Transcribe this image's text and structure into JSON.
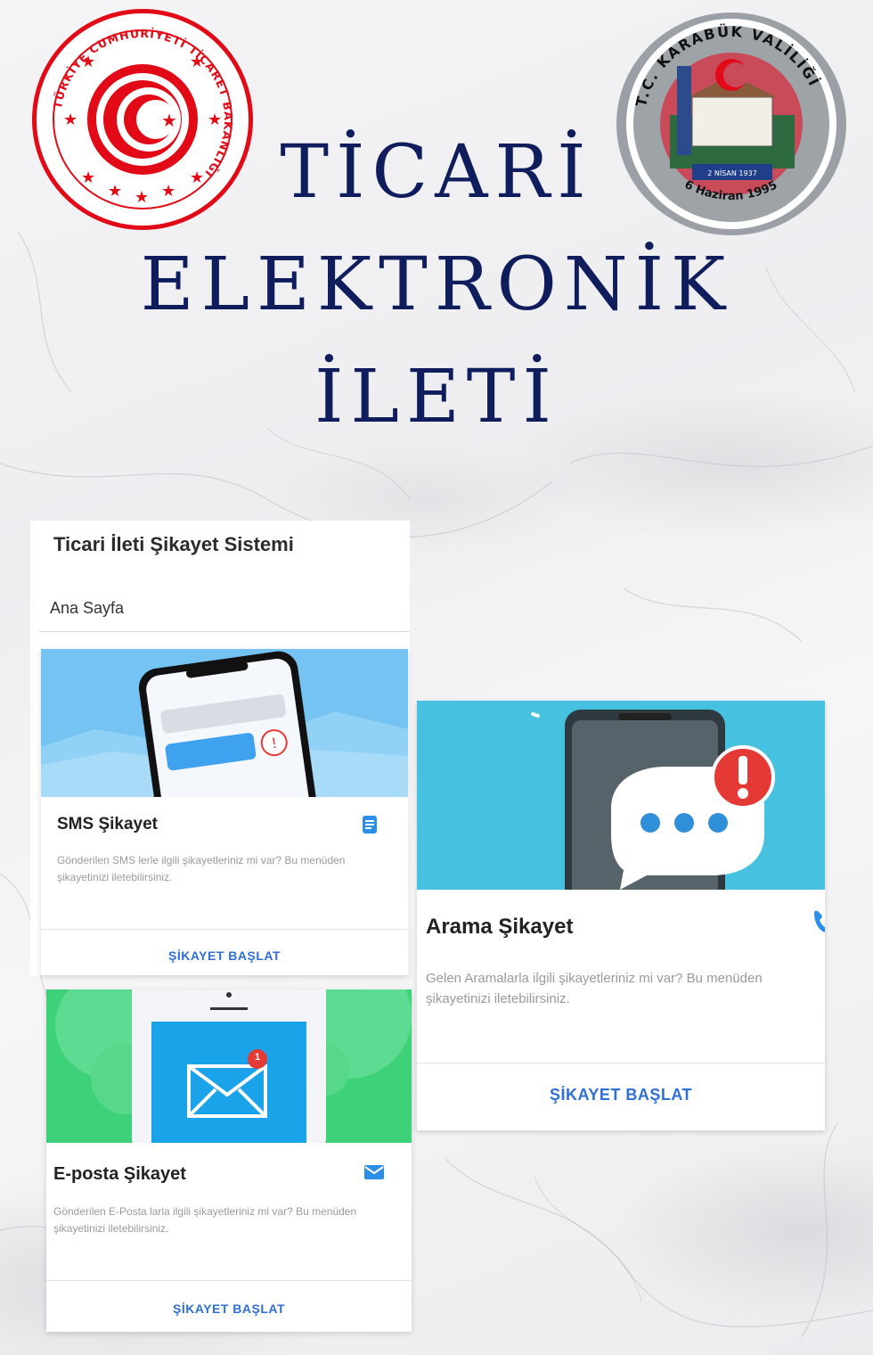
{
  "title": {
    "line1": "TİCARİ",
    "line2": "ELEKTRONİK",
    "line3": "İLETİ"
  },
  "logos": {
    "left": {
      "name": "ticaret-bakanligi-logo",
      "ring_text": "TÜRKİYE CUMHURİYETİ TİCARET BAKANLIĞI"
    },
    "right": {
      "name": "karabuk-valiligi-logo",
      "ring_text": "T.C. KARABÜK VALİLİĞİ",
      "ribbon_text": "2 NİSAN 1937",
      "bottom_text": "6 Haziran 1995"
    }
  },
  "app": {
    "title": "Ticari İleti Şikayet Sistemi",
    "breadcrumb": "Ana Sayfa"
  },
  "cards": {
    "sms": {
      "title": "SMS Şikayet",
      "description": "Gönderilen SMS lerle ilgili şikayetleriniz mi var? Bu menüden şikayetinizi iletebilirsiniz.",
      "action": "ŞİKAYET BAŞLAT",
      "icon": "sms-icon"
    },
    "arama": {
      "title": "Arama Şikayet",
      "description": "Gelen Aramalarla ilgili şikayetleriniz mi var? Bu menüden şikayetinizi iletebilirsiniz.",
      "action": "ŞİKAYET BAŞLAT",
      "icon": "phone-icon"
    },
    "eposta": {
      "title": "E-posta Şikayet",
      "description": "Gönderilen E-Posta larla ilgili şikayetleriniz mi var? Bu menüden şikayetinizi iletebilirsiniz.",
      "action": "ŞİKAYET BAŞLAT",
      "icon": "mail-icon",
      "badge": "1"
    }
  },
  "colors": {
    "title_navy": "#0f1d5c",
    "action_blue": "#2f6fd6",
    "icon_blue": "#2b8fe8",
    "sms_sky": "#74c3f2",
    "arama_teal": "#46c1e0",
    "eposta_green": "#3dd17a",
    "alert_red": "#e53935"
  }
}
